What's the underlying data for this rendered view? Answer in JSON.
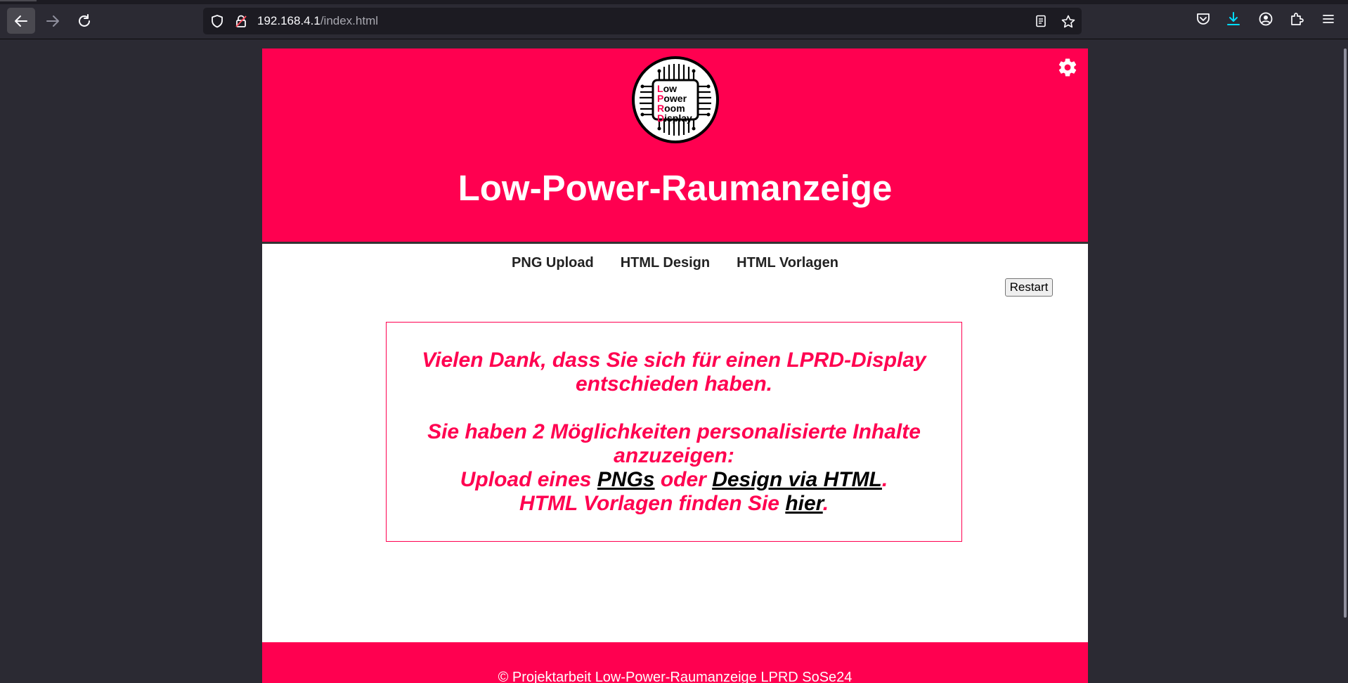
{
  "browser": {
    "url_host": "192.168.4.1",
    "url_path": "/index.html"
  },
  "header": {
    "logo_lines": [
      {
        "first": "L",
        "rest": "ow"
      },
      {
        "first": "P",
        "rest": "ower"
      },
      {
        "first": "R",
        "rest": "oom"
      },
      {
        "first": "D",
        "rest": "isplay"
      }
    ],
    "title": "Low-Power-Raumanzeige"
  },
  "nav": {
    "items": [
      {
        "label": "PNG Upload"
      },
      {
        "label": "HTML Design"
      },
      {
        "label": "HTML Vorlagen"
      }
    ],
    "restart_label": "Restart"
  },
  "welcome": {
    "thanks": "Vielen Dank, dass Sie sich für einen LPRD-Display entschieden haben.",
    "options_intro": "Sie haben 2 Möglichkeiten personalisierte Inhalte anzuzeigen:",
    "upload_prefix": "Upload eines ",
    "upload_link_png": "PNGs",
    "upload_middle": " oder ",
    "upload_link_html": "Design via HTML",
    "upload_suffix": ".",
    "templates_prefix": "HTML Vorlagen finden Sie ",
    "templates_link": "hier",
    "templates_suffix": "."
  },
  "footer": {
    "text": "© Projektarbeit Low-Power-Raumanzeige LPRD SoSe24"
  },
  "colors": {
    "brand": "#ff0050",
    "chrome": "#2b2a33"
  },
  "icons": [
    "back-arrow-icon",
    "forward-arrow-icon",
    "reload-icon",
    "shield-icon",
    "insecure-lock-icon",
    "reader-view-icon",
    "bookmark-star-icon",
    "pocket-icon",
    "download-icon",
    "account-icon",
    "extensions-icon",
    "menu-icon",
    "gear-icon"
  ]
}
